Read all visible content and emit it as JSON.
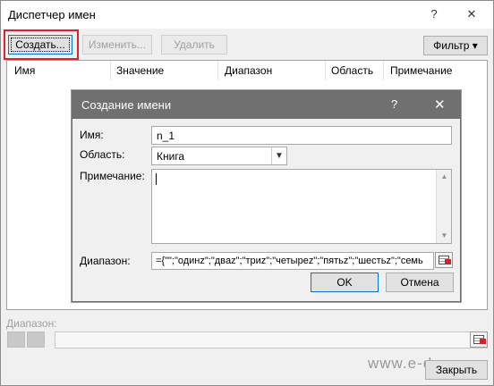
{
  "window": {
    "title": "Диспетчер имен",
    "help_glyph": "?",
    "close_glyph": "✕"
  },
  "toolbar": {
    "create_label": "Создать...",
    "edit_label": "Изменить...",
    "delete_label": "Удалить",
    "filter_label": "Фильтр ▾"
  },
  "list": {
    "columns": [
      "Имя",
      "Значение",
      "Диапазон",
      "Область",
      "Примечание"
    ]
  },
  "bottom": {
    "range_label": "Диапазон:",
    "close_label": "Закрыть",
    "watermark": "www.e-du.ru"
  },
  "dialog": {
    "title": "Создание имени",
    "help_glyph": "?",
    "close_glyph": "✕",
    "name_label": "Имя:",
    "name_value": "n_1",
    "scope_label": "Область:",
    "scope_value": "Книга",
    "comment_label": "Примечание:",
    "range_label": "Диапазон:",
    "range_value": "={\"\";\"одинz\";\"двaz\";\"триz\";\"четырez\";\"пятьz\";\"шестьz\";\"семь",
    "ok_label": "OK",
    "cancel_label": "Отмена"
  }
}
